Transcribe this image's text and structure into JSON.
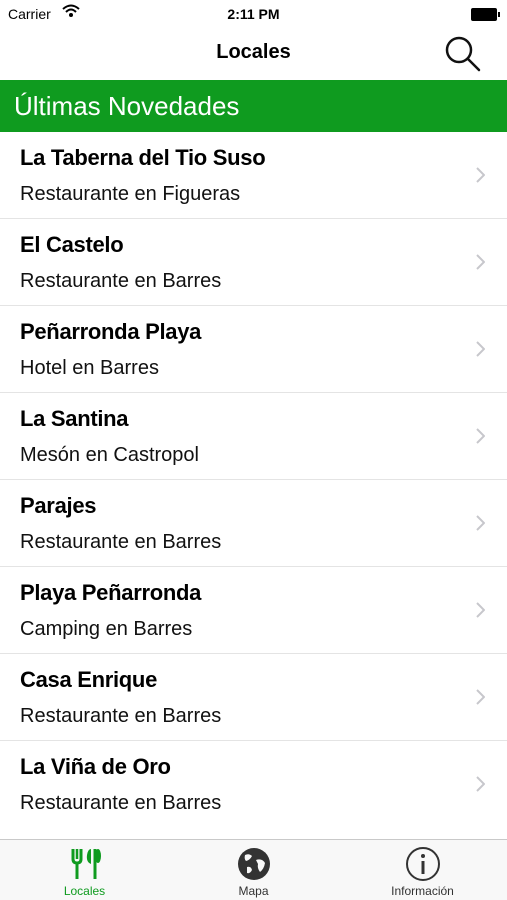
{
  "status_bar": {
    "carrier": "Carrier",
    "time": "2:11 PM"
  },
  "nav": {
    "title": "Locales",
    "search_icon": "search-icon"
  },
  "section": {
    "title": "Últimas Novedades"
  },
  "colors": {
    "accent": "#0f9b1f"
  },
  "items": [
    {
      "title": "La Taberna del Tio Suso",
      "subtitle": "Restaurante en Figueras"
    },
    {
      "title": "El Castelo",
      "subtitle": "Restaurante en Barres"
    },
    {
      "title": "Peñarronda Playa",
      "subtitle": "Hotel en Barres"
    },
    {
      "title": "La Santina",
      "subtitle": "Mesón en Castropol"
    },
    {
      "title": "Parajes",
      "subtitle": "Restaurante en Barres"
    },
    {
      "title": "Playa Peñarronda",
      "subtitle": "Camping en Barres"
    },
    {
      "title": "Casa Enrique",
      "subtitle": "Restaurante en Barres"
    },
    {
      "title": "La Viña de Oro",
      "subtitle": "Restaurante en Barres"
    }
  ],
  "tabs": [
    {
      "label": "Locales",
      "icon": "utensils-icon",
      "active": true
    },
    {
      "label": "Mapa",
      "icon": "globe-icon",
      "active": false
    },
    {
      "label": "Información",
      "icon": "info-icon",
      "active": false
    }
  ]
}
